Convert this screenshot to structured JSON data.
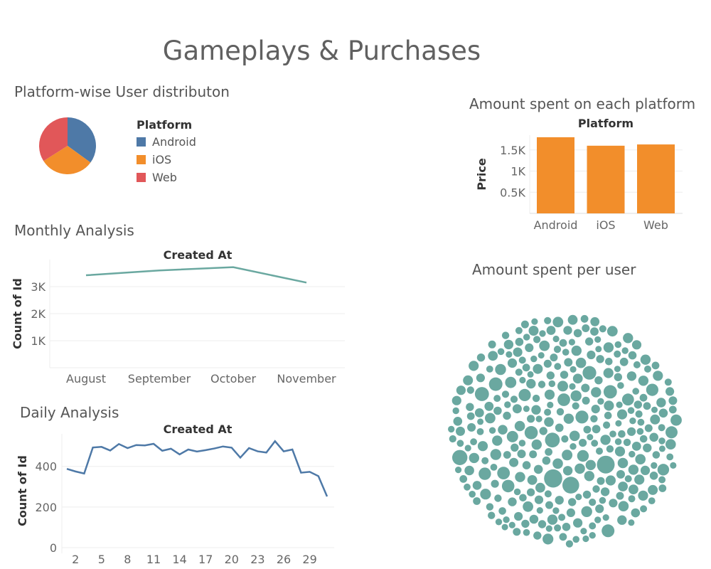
{
  "dashboard": {
    "title": "Gameplays & Purchases"
  },
  "colors": {
    "android": "#4e79a7",
    "ios": "#f28e2b",
    "web": "#e15759",
    "teal": "#6aa8a0",
    "bar": "#f28e2b",
    "daily": "#4e79a7"
  },
  "platform_panel": {
    "title": "Platform-wise User distributon",
    "legend_title": "Platform",
    "items": [
      {
        "label": "Android",
        "color": "#4e79a7"
      },
      {
        "label": "iOS",
        "color": "#f28e2b"
      },
      {
        "label": "Web",
        "color": "#e15759"
      }
    ]
  },
  "spend_platform_panel": {
    "title": "Amount spent on each platform"
  },
  "monthly_panel": {
    "title": "Monthly Analysis"
  },
  "daily_panel": {
    "title": "Daily Analysis"
  },
  "per_user_panel": {
    "title": "Amount spent per user"
  },
  "chart_data": [
    {
      "id": "pie",
      "type": "pie",
      "categories": [
        "Android",
        "iOS",
        "Web"
      ],
      "values": [
        35,
        31,
        34
      ]
    },
    {
      "id": "platform_bar",
      "type": "bar",
      "title": "Platform",
      "categories": [
        "Android",
        "iOS",
        "Web"
      ],
      "values": [
        1800,
        1600,
        1630
      ],
      "ylabel": "Price",
      "ylim": [
        0,
        1850
      ],
      "yticks": [
        500,
        1000,
        1500
      ],
      "ytick_labels": [
        "0.5K",
        "1K",
        "1.5K"
      ],
      "grid": true
    },
    {
      "id": "monthly",
      "type": "line",
      "title": "Created At",
      "categories": [
        "August",
        "September",
        "October",
        "November"
      ],
      "values": [
        3420,
        3600,
        3720,
        3150
      ],
      "ylabel": "Count of Id",
      "ylim": [
        0,
        4000
      ],
      "yticks": [
        1000,
        2000,
        3000
      ],
      "ytick_labels": [
        "1K",
        "2K",
        "3K"
      ],
      "grid": true
    },
    {
      "id": "daily",
      "type": "line",
      "title": "Created At",
      "x": [
        1,
        2,
        3,
        4,
        5,
        6,
        7,
        8,
        9,
        10,
        11,
        12,
        13,
        14,
        15,
        16,
        17,
        18,
        19,
        20,
        21,
        22,
        23,
        24,
        25,
        26,
        27,
        28,
        29,
        30,
        31
      ],
      "values": [
        388,
        375,
        365,
        493,
        496,
        478,
        510,
        490,
        505,
        503,
        511,
        477,
        487,
        459,
        483,
        473,
        480,
        488,
        498,
        492,
        443,
        490,
        474,
        468,
        524,
        474,
        483,
        369,
        373,
        352,
        252
      ],
      "xtick_labels": [
        "2",
        "5",
        "8",
        "11",
        "14",
        "17",
        "20",
        "23",
        "26",
        "29"
      ],
      "xtick_values": [
        2,
        5,
        8,
        11,
        14,
        17,
        20,
        23,
        26,
        29
      ],
      "ylabel": "Count of Id",
      "ylim": [
        0,
        560
      ],
      "yticks": [
        0,
        200,
        400
      ],
      "ytick_labels": [
        "0",
        "200",
        "400"
      ],
      "grid": true
    },
    {
      "id": "bubbles",
      "type": "packed-bubble",
      "count": 620,
      "measure": "Amount spent per user"
    }
  ]
}
